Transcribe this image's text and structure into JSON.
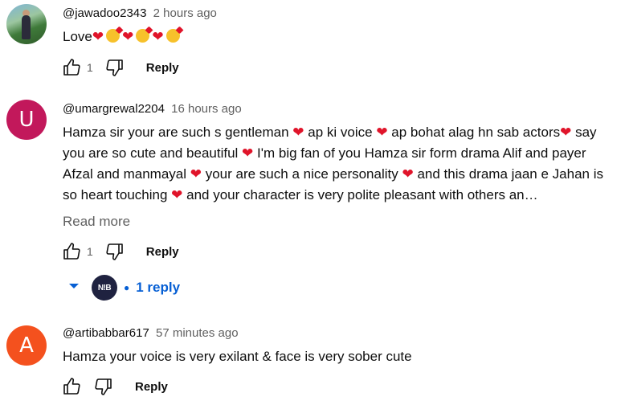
{
  "colors": {
    "avatar_u": "#c2185b",
    "avatar_a": "#f4511e",
    "link_blue": "#065fd4"
  },
  "comments": [
    {
      "author": "@jawadoo2343",
      "time": "2 hours ago",
      "text_prefix": "Love",
      "likes": "1",
      "reply_label": "Reply"
    },
    {
      "author": "@umargrewal2204",
      "avatar_letter": "U",
      "time": "16 hours ago",
      "segments": [
        "Hamza sir your are such s gentleman ",
        " ap ki voice ",
        " ap bohat alag hn sab actors",
        " say you are so cute and beautiful ",
        "  I'm big fan of you Hamza sir form drama Alif and payer Afzal and manmayal ",
        " your are such a nice personality ",
        " and this drama jaan e Jahan is so heart touching ",
        " and your character is very polite pleasant with others an…"
      ],
      "read_more": "Read more",
      "likes": "1",
      "reply_label": "Reply",
      "replies_avatar_text": "N!B",
      "replies_label": "1 reply"
    },
    {
      "author": "@artibabbar617",
      "avatar_letter": "A",
      "time": "57 minutes ago",
      "text": "Hamza your voice is very exilant & face is very sober cute",
      "reply_label": "Reply"
    }
  ]
}
